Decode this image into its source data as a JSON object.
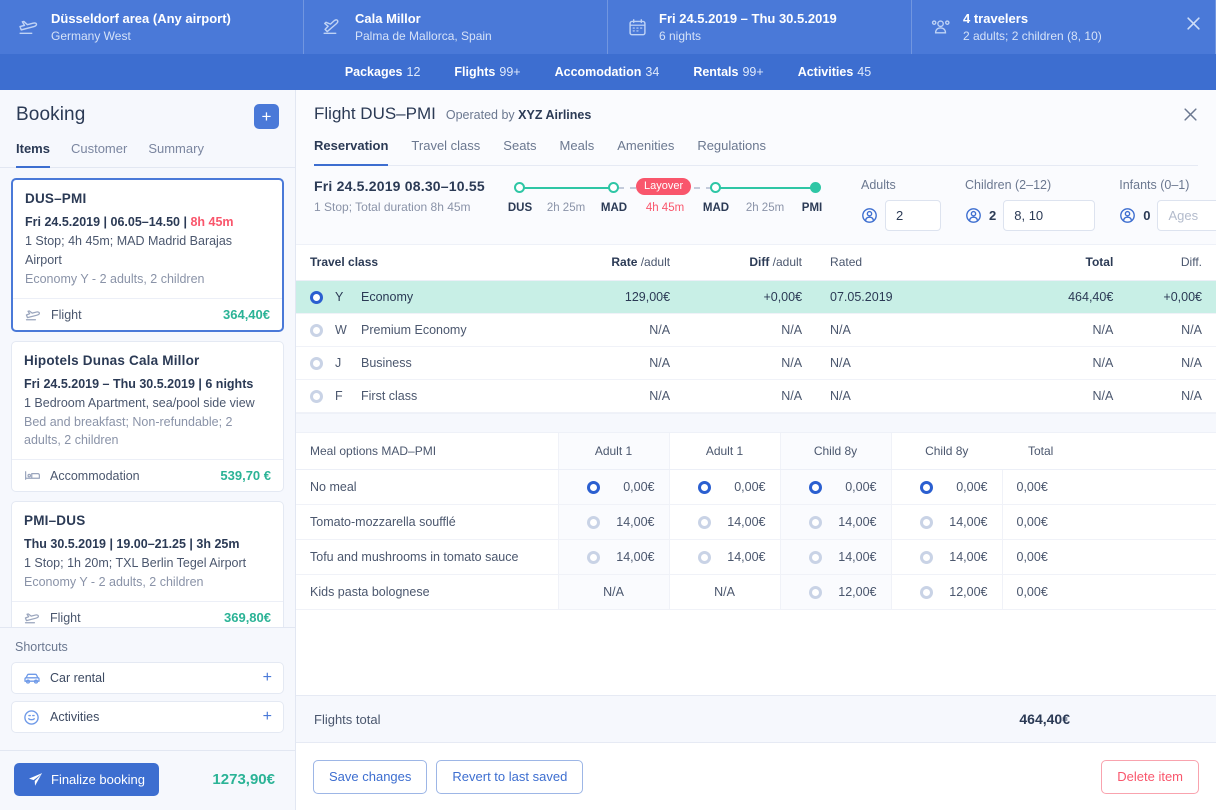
{
  "topbar": {
    "cells": [
      {
        "icon": "departure-plane-icon",
        "title": "Düsseldorf area (Any airport)",
        "sub": "Germany West"
      },
      {
        "icon": "arrival-plane-icon",
        "title": "Cala Millor",
        "sub": "Palma de Mallorca, Spain"
      },
      {
        "icon": "calendar-icon",
        "title": "Fri 24.5.2019 – Thu 30.5.2019",
        "sub": "6 nights"
      },
      {
        "icon": "travelers-icon",
        "title": "4 travelers",
        "sub": "2 adults; 2 children (8, 10)"
      }
    ],
    "close_icon": "close-icon"
  },
  "nav": {
    "items": [
      {
        "label": "Packages",
        "count": "12"
      },
      {
        "label": "Flights",
        "count": "99+"
      },
      {
        "label": "Accomodation",
        "count": "34"
      },
      {
        "label": "Rentals",
        "count": "99+"
      },
      {
        "label": "Activities",
        "count": "45"
      }
    ]
  },
  "sidebar": {
    "title": "Booking",
    "add_label": "+",
    "tabs": [
      {
        "label": "Items",
        "active": true
      },
      {
        "label": "Customer",
        "active": false
      },
      {
        "label": "Summary",
        "active": false
      }
    ],
    "items": [
      {
        "title": "DUS–PMI",
        "line1_main": "Fri 24.5.2019 | 06.05–14.50 | ",
        "line1_warn": "8h 45m",
        "line2": "1 Stop; 4h 45m; MAD Madrid Barajas Airport",
        "line3": "Economy Y - 2 adults, 2 children",
        "type": "Flight",
        "type_icon": "flight-icon",
        "price": "364,40€",
        "selected": true
      },
      {
        "title": "Hipotels Dunas Cala Millor",
        "line1_main": "Fri 24.5.2019 – Thu 30.5.2019 | 6 nights",
        "line1_warn": "",
        "line2": "1 Bedroom Apartment, sea/pool side view",
        "line3": "Bed and breakfast; Non-refundable; 2 adults, 2 children",
        "type": "Accommodation",
        "type_icon": "bed-icon",
        "price": "539,70 €",
        "selected": false
      },
      {
        "title": "PMI–DUS",
        "line1_main": "Thu 30.5.2019 | 19.00–21.25 | 3h 25m",
        "line1_warn": "",
        "line2": "1 Stop; 1h 20m; TXL Berlin Tegel Airport",
        "line3": "Economy Y - 2 adults, 2 children",
        "type": "Flight",
        "type_icon": "flight-icon",
        "price": "369,80€",
        "selected": false
      }
    ],
    "shortcuts_label": "Shortcuts",
    "shortcuts": [
      {
        "label": "Car rental",
        "icon": "car-icon",
        "add": "+"
      },
      {
        "label": "Activities",
        "icon": "smiley-icon",
        "add": "+"
      }
    ],
    "finalize_label": "Finalize booking",
    "finalize_icon": "send-icon",
    "grand_total": "1273,90€"
  },
  "main": {
    "title": "Flight DUS–PMI",
    "operated_prefix": "Operated by ",
    "operated_by": "XYZ Airlines",
    "close_icon": "close-icon",
    "tabs": [
      {
        "label": "Reservation",
        "active": true
      },
      {
        "label": "Travel class",
        "active": false
      },
      {
        "label": "Seats",
        "active": false
      },
      {
        "label": "Meals",
        "active": false
      },
      {
        "label": "Amenities",
        "active": false
      },
      {
        "label": "Regulations",
        "active": false
      }
    ],
    "reservation": {
      "date": "Fri 24.5.2019  08.30–10.55",
      "sub": "1 Stop; Total duration 8h 45m",
      "timeline": {
        "stops": [
          "DUS",
          "MAD",
          "MAD",
          "PMI"
        ],
        "segments": [
          "2h 25m",
          "2h 25m"
        ],
        "layover_badge": "Layover",
        "layover_duration": "4h 45m"
      },
      "pax": [
        {
          "label": "Adults",
          "icon": "person-icon",
          "count": "",
          "value": "2",
          "placeholder": ""
        },
        {
          "label": "Children (2–12)",
          "icon": "person-icon",
          "count": "2",
          "value": "8, 10",
          "placeholder": ""
        },
        {
          "label": "Infants (0–1)",
          "icon": "person-icon",
          "count": "0",
          "value": "",
          "placeholder": "Ages"
        }
      ]
    },
    "travel_class_table": {
      "headers": [
        "Travel class",
        "Rate /adult",
        "Diff /adult",
        "Rated",
        "Total",
        "Diff."
      ],
      "header_bold": [
        "Travel class",
        "Rate",
        "Diff",
        "Rated",
        "Total",
        "Diff."
      ],
      "rows": [
        {
          "code": "Y",
          "name": "Economy",
          "rate": "129,00€",
          "diff_adult": "+0,00€",
          "rated": "07.05.2019",
          "total": "464,40€",
          "diff": "+0,00€",
          "selected": true
        },
        {
          "code": "W",
          "name": "Premium Economy",
          "rate": "N/A",
          "diff_adult": "N/A",
          "rated": "N/A",
          "total": "N/A",
          "diff": "N/A",
          "selected": false
        },
        {
          "code": "J",
          "name": "Business",
          "rate": "N/A",
          "diff_adult": "N/A",
          "rated": "N/A",
          "total": "N/A",
          "diff": "N/A",
          "selected": false
        },
        {
          "code": "F",
          "name": "First class",
          "rate": "N/A",
          "diff_adult": "N/A",
          "rated": "N/A",
          "total": "N/A",
          "diff": "N/A",
          "selected": false
        }
      ]
    },
    "meal_table": {
      "title": "Meal options MAD–PMI",
      "columns": [
        "Adult 1",
        "Adult 1",
        "Child 8y",
        "Child 8y",
        "Total"
      ],
      "rows": [
        {
          "name": "No meal",
          "cells": [
            "0,00€",
            "0,00€",
            "0,00€",
            "0,00€"
          ],
          "selected": [
            true,
            true,
            true,
            true
          ],
          "na": [
            false,
            false,
            false,
            false
          ],
          "total": "0,00€"
        },
        {
          "name": "Tomato-mozzarella soufflé",
          "cells": [
            "14,00€",
            "14,00€",
            "14,00€",
            "14,00€"
          ],
          "selected": [
            false,
            false,
            false,
            false
          ],
          "na": [
            false,
            false,
            false,
            false
          ],
          "total": "0,00€"
        },
        {
          "name": "Tofu and mushrooms in tomato sauce",
          "cells": [
            "14,00€",
            "14,00€",
            "14,00€",
            "14,00€"
          ],
          "selected": [
            false,
            false,
            false,
            false
          ],
          "na": [
            false,
            false,
            false,
            false
          ],
          "total": "0,00€"
        },
        {
          "name": "Kids pasta bolognese",
          "cells": [
            "N/A",
            "N/A",
            "12,00€",
            "12,00€"
          ],
          "selected": [
            false,
            false,
            false,
            false
          ],
          "na": [
            true,
            true,
            false,
            false
          ],
          "total": "0,00€"
        }
      ]
    },
    "totals": {
      "label": "Flights total",
      "value": "464,40€"
    },
    "actions": {
      "save": "Save changes",
      "revert": "Revert to last saved",
      "delete": "Delete item"
    }
  },
  "colors": {
    "brand_blue": "#3d6ed0",
    "topbar_blue": "#4a79d8",
    "accent_green": "#2bb396",
    "warn_red": "#f9566c",
    "selected_row": "#c8efe6"
  }
}
